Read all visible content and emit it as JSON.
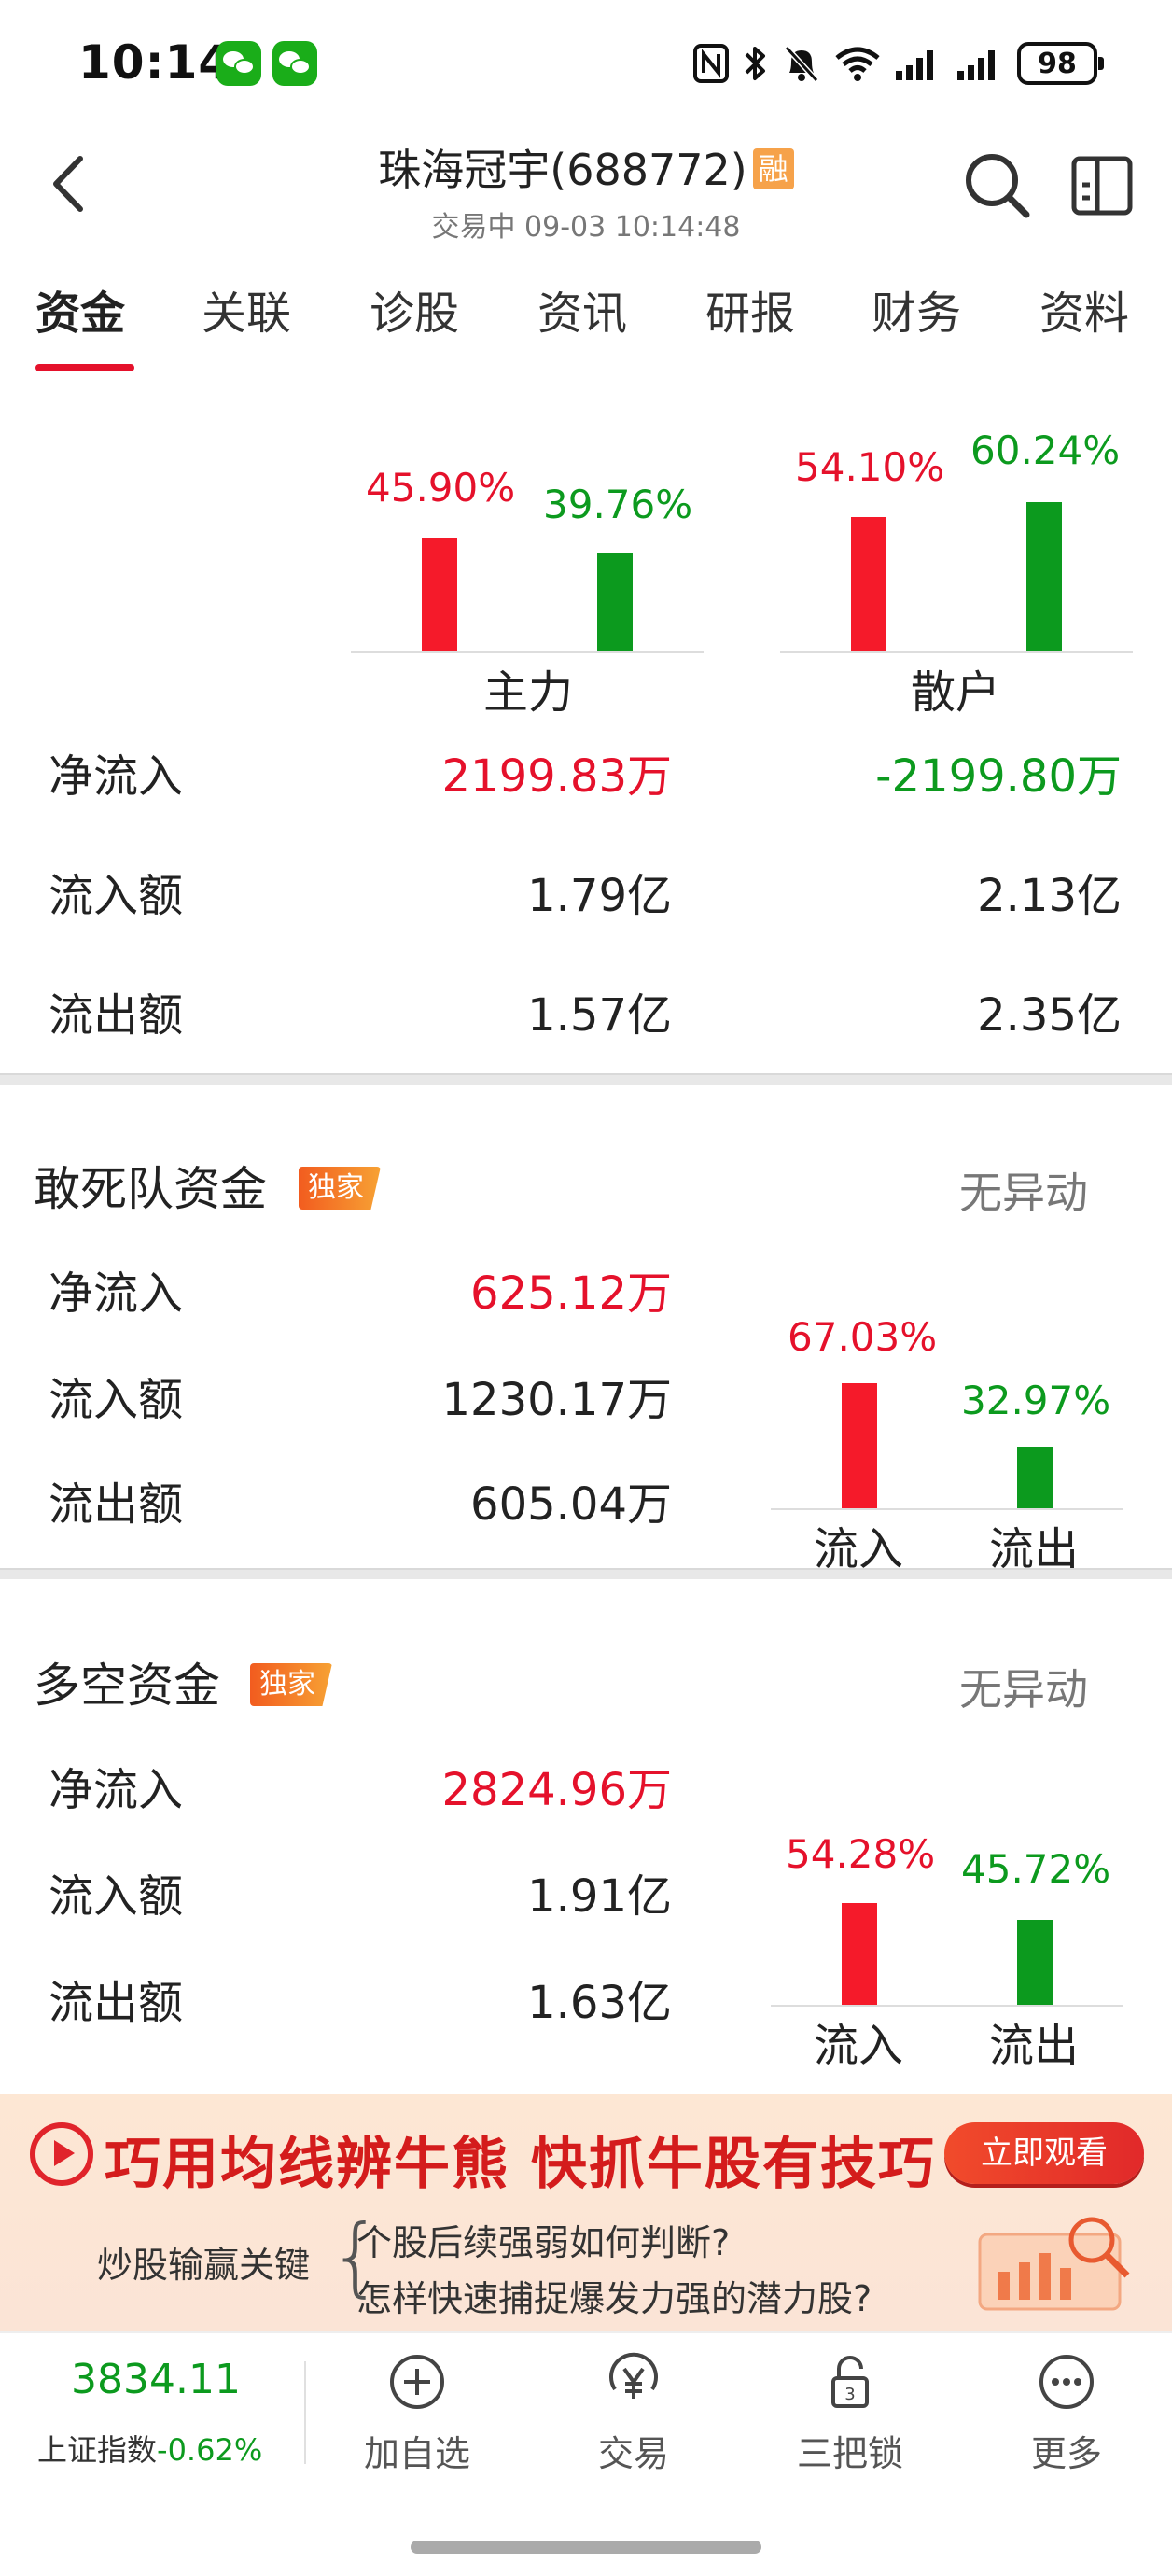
{
  "status_bar": {
    "time": "10:14",
    "battery": "98",
    "icons": [
      "wechat-icon",
      "wechat-icon",
      "nfc-icon",
      "bluetooth-icon",
      "mute-bell-icon",
      "wifi-icon",
      "signal-icon",
      "signal-icon",
      "battery-icon"
    ]
  },
  "header": {
    "title": "珠海冠宇(688772)",
    "badge": "融",
    "subtitle": "交易中 09-03 10:14:48"
  },
  "tabs": [
    "资金",
    "关联",
    "诊股",
    "资讯",
    "研报",
    "财务",
    "资料"
  ],
  "active_tab": 0,
  "main_flow": {
    "groups": [
      {
        "label": "主力",
        "inflow_pct": "45.90%",
        "outflow_pct": "39.76%",
        "inflow_ratio": 0.459,
        "outflow_ratio": 0.3976
      },
      {
        "label": "散户",
        "inflow_pct": "54.10%",
        "outflow_pct": "60.24%",
        "inflow_ratio": 0.541,
        "outflow_ratio": 0.6024
      }
    ],
    "rows": [
      {
        "label": "净流入",
        "main": "2199.83万",
        "retail": "-2199.80万"
      },
      {
        "label": "流入额",
        "main": "1.79亿",
        "retail": "2.13亿"
      },
      {
        "label": "流出额",
        "main": "1.57亿",
        "retail": "2.35亿"
      }
    ]
  },
  "daredevil": {
    "title": "敢死队资金",
    "badge": "独家",
    "status": "无异动",
    "rows": [
      {
        "label": "净流入",
        "value": "625.12万"
      },
      {
        "label": "流入额",
        "value": "1230.17万"
      },
      {
        "label": "流出额",
        "value": "605.04万"
      }
    ],
    "chart": {
      "in_pct": "67.03%",
      "out_pct": "32.97%",
      "in_ratio": 0.6703,
      "out_ratio": 0.3297,
      "in_label": "流入",
      "out_label": "流出"
    }
  },
  "longshort": {
    "title": "多空资金",
    "badge": "独家",
    "status": "无异动",
    "rows": [
      {
        "label": "净流入",
        "value": "2824.96万"
      },
      {
        "label": "流入额",
        "value": "1.91亿"
      },
      {
        "label": "流出额",
        "value": "1.63亿"
      }
    ],
    "chart": {
      "in_pct": "54.28%",
      "out_pct": "45.72%",
      "in_ratio": 0.5428,
      "out_ratio": 0.4572,
      "in_label": "流入",
      "out_label": "流出"
    }
  },
  "banner": {
    "headline": "巧用均线辨牛熊 快抓牛股有技巧",
    "button": "立即观看",
    "left_text": "炒股输赢关键",
    "question1": "个股后续强弱如何判断?",
    "question2": "怎样快速捕捉爆发力强的潜力股?"
  },
  "bottom_nav": {
    "index_value": "3834.11",
    "index_name": "上证指数",
    "index_change": "-0.62%",
    "items": [
      {
        "label": "加自选",
        "icon": "plus-circle-icon"
      },
      {
        "label": "交易",
        "icon": "yen-circle-icon"
      },
      {
        "label": "三把锁",
        "icon": "lock-icon"
      },
      {
        "label": "更多",
        "icon": "more-icon"
      }
    ]
  },
  "colors": {
    "red": "#e5112b",
    "green": "#0c9a1e",
    "accent_orange": "#f6a24a"
  }
}
